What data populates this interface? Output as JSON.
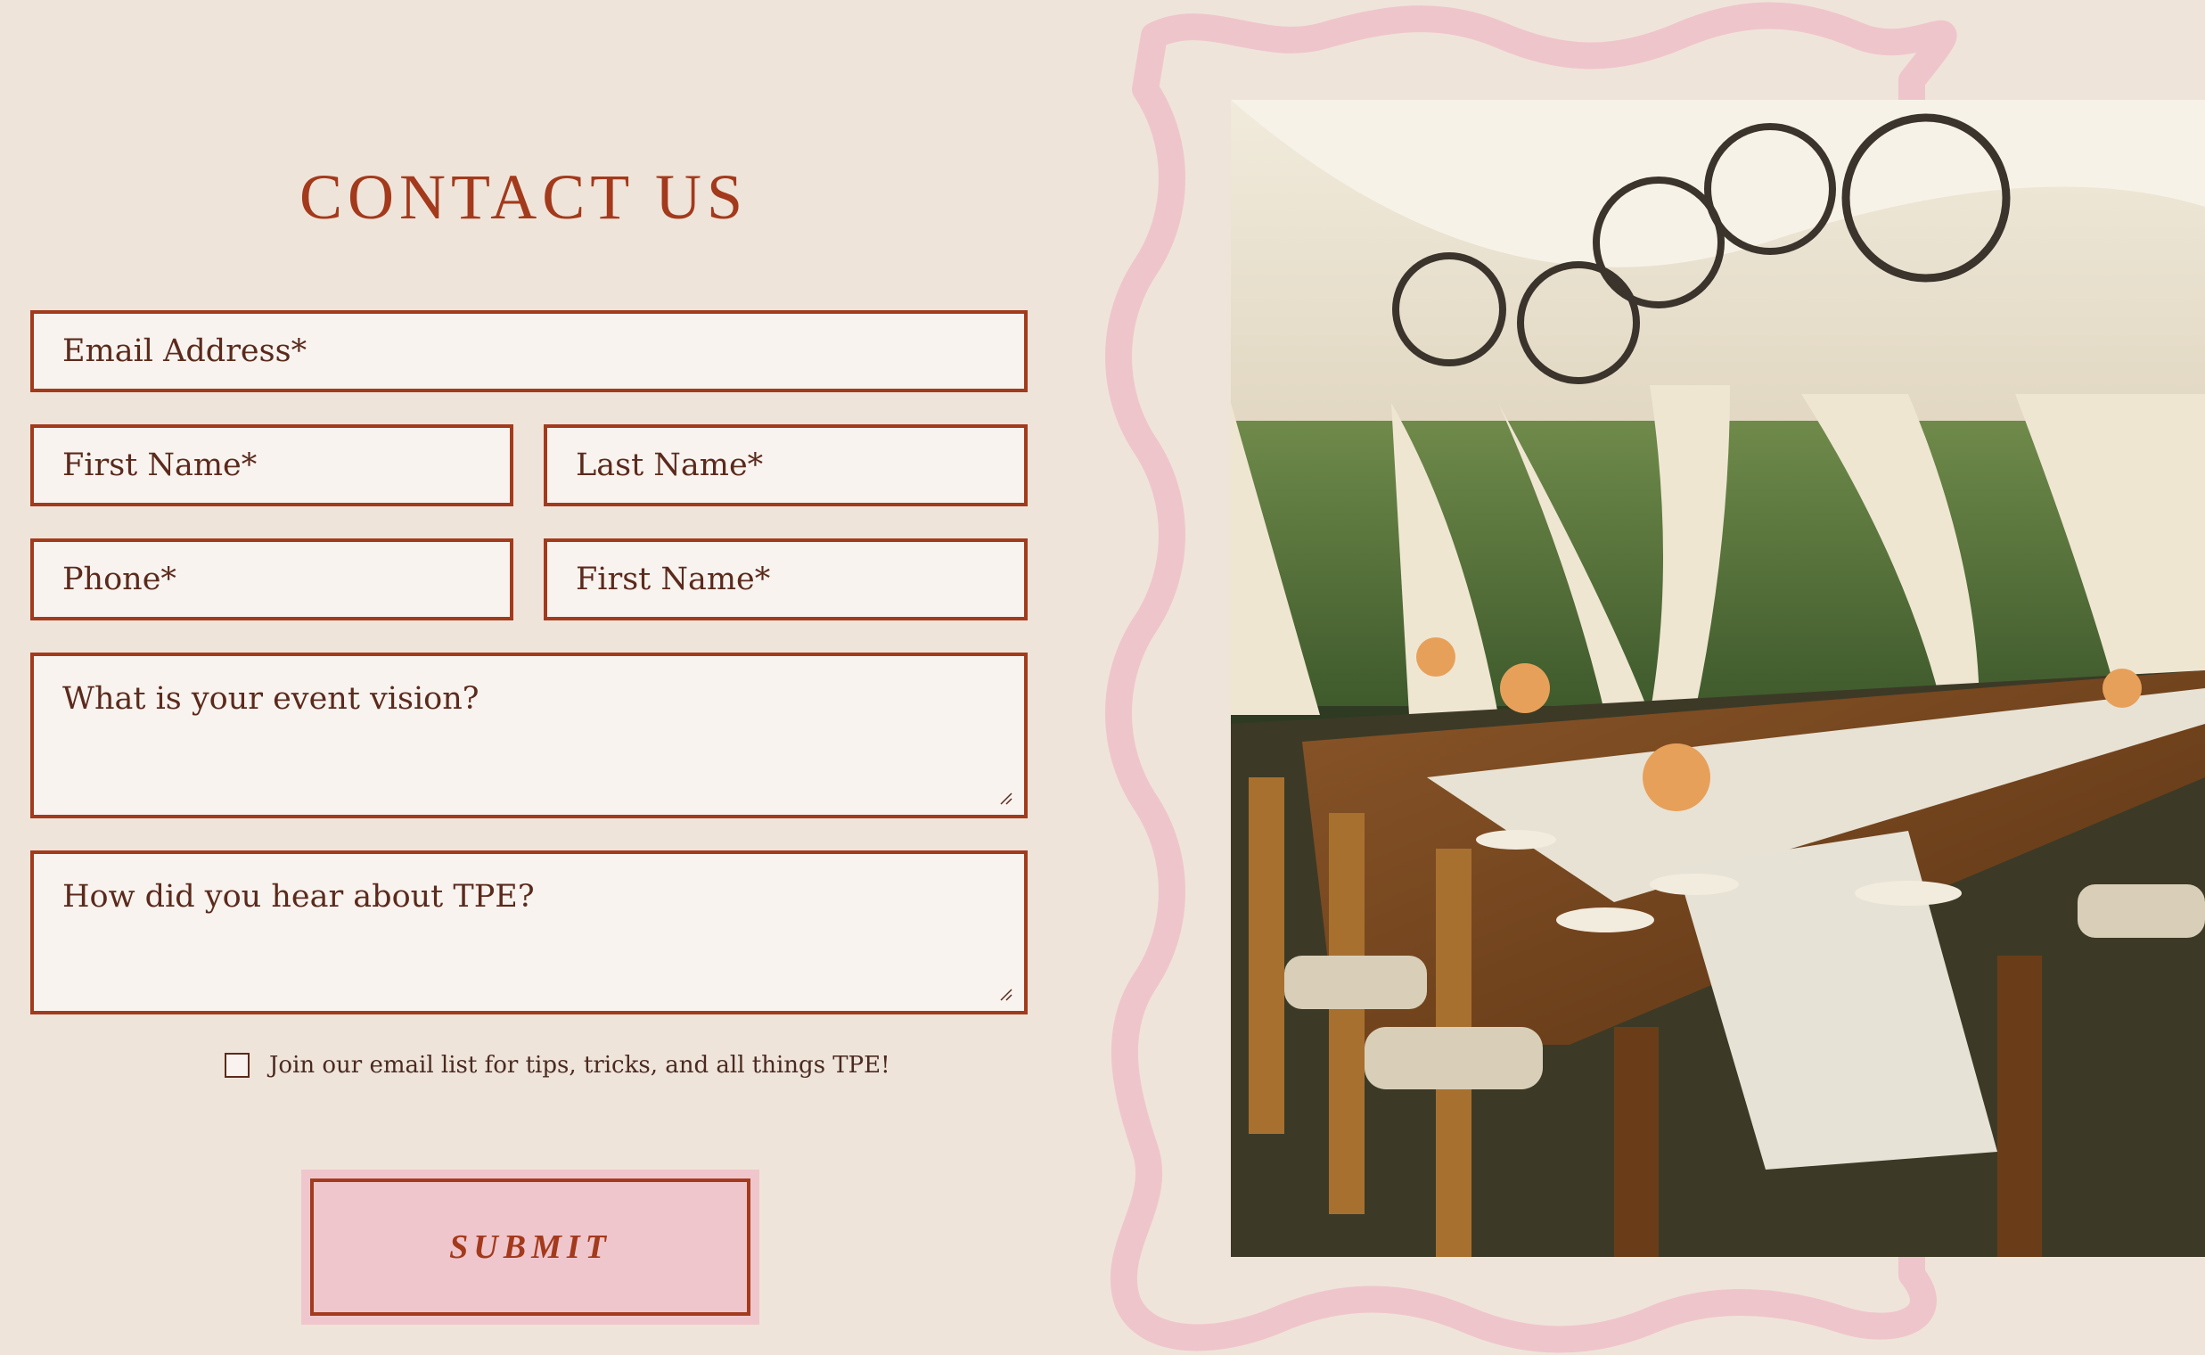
{
  "form": {
    "title": "CONTACT US",
    "email_placeholder": "Email Address*",
    "first_name_placeholder": "First Name*",
    "last_name_placeholder": "Last Name*",
    "phone_placeholder": "Phone*",
    "second_first_name_placeholder": "First Name*",
    "event_vision_placeholder": "What is your event vision?",
    "hear_about_placeholder": "How did you hear about TPE?",
    "newsletter_label": "Join our email list for tips, tricks, and all things TPE!",
    "submit_label": "SUBMIT"
  },
  "colors": {
    "background": "#efe4da",
    "accent": "#a33a1c",
    "field_bg": "#f8f3ef",
    "pink": "#f0c6cd"
  },
  "image": {
    "subject": "tented event with long wooden banquet table, chandeliers, flowers"
  }
}
